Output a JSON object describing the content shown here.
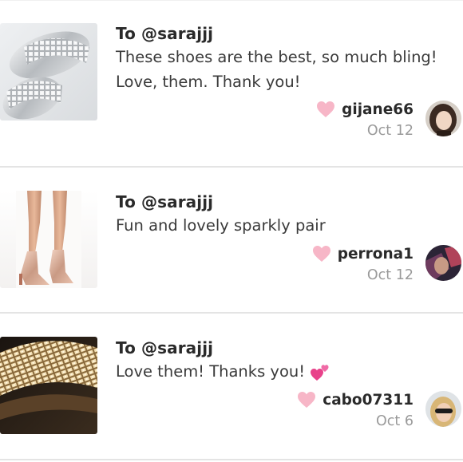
{
  "colors": {
    "heart": "#f7b6c7",
    "divider": "#e4e4e4",
    "date": "#9a9a9a"
  },
  "reviews": [
    {
      "to": "To @sarajjj",
      "message": "These shoes are the best, so much bling! Love, them. Thank you!",
      "username": "gijane66",
      "date": "Oct 12",
      "product": "silver rhinestone slide sandals",
      "avatar": "user photo"
    },
    {
      "to": "To @sarajjj",
      "message": "Fun and lovely sparkly pair",
      "username": "perrona1",
      "date": "Oct 12",
      "product": "rose gold metallic ankle boots",
      "avatar": "user photo"
    },
    {
      "to": "To @sarajjj",
      "message": "Love them! Thanks you!",
      "username": "cabo07311",
      "date": "Oct 6",
      "product": "gold rhinestone slide strap",
      "avatar": "user photo",
      "emoji": "two-hearts-icon"
    }
  ]
}
